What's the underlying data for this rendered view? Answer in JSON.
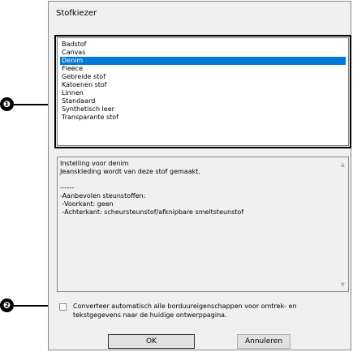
{
  "dialog": {
    "title": "Stofkiezer",
    "fabric_list": [
      {
        "label": "Badstof",
        "selected": false
      },
      {
        "label": "Canvas",
        "selected": false
      },
      {
        "label": "Denim",
        "selected": true
      },
      {
        "label": "Fleece",
        "selected": false
      },
      {
        "label": "Gebreide stof",
        "selected": false
      },
      {
        "label": "Katoenen stof",
        "selected": false
      },
      {
        "label": "Linnen",
        "selected": false
      },
      {
        "label": "Standaard",
        "selected": false
      },
      {
        "label": "Synthetisch leer",
        "selected": false
      },
      {
        "label": "Transparante stof",
        "selected": false
      }
    ],
    "info_text": "Instelling voor denim\nJeanskleding wordt van deze stof gemaakt.\n\n------\n-Aanbevolen steunstoffen:\n -Voorkant: geen\n -Achterkant: scheursteunstof/afknipbare smeltsteunstof",
    "auto_convert_checkbox": {
      "label": "Converteer automatisch alle borduureigenschappen voor omtrek- en tekstgegevens naar de huidige ontwerppagina.",
      "checked": false
    },
    "buttons": {
      "ok": "OK",
      "cancel": "Annuleren"
    }
  },
  "callouts": [
    "❶",
    "❷"
  ],
  "colors": {
    "selection": "#0078d7",
    "dialog_bg": "#f0f0f0"
  }
}
